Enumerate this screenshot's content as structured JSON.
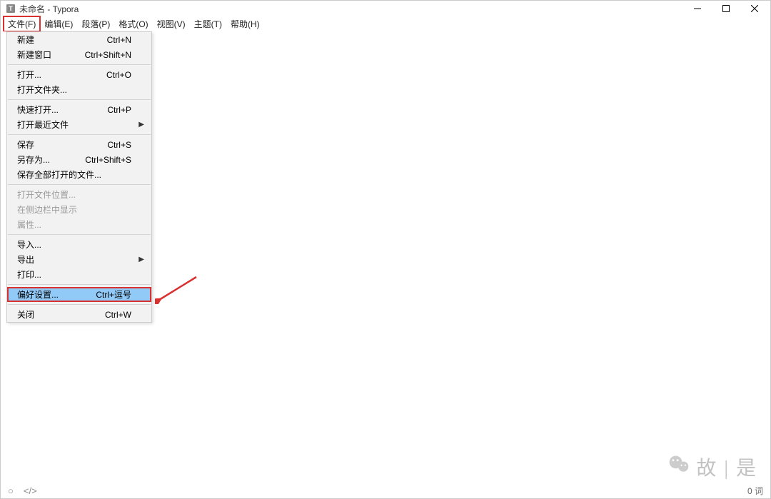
{
  "titlebar": {
    "app_icon_letter": "T",
    "title": "未命名 - Typora"
  },
  "menubar": {
    "items": [
      {
        "label": "文件(F)",
        "highlighted": true
      },
      {
        "label": "编辑(E)"
      },
      {
        "label": "段落(P)"
      },
      {
        "label": "格式(O)"
      },
      {
        "label": "视图(V)"
      },
      {
        "label": "主题(T)"
      },
      {
        "label": "帮助(H)"
      }
    ]
  },
  "dropdown": {
    "groups": [
      [
        {
          "label": "新建",
          "shortcut": "Ctrl+N"
        },
        {
          "label": "新建窗口",
          "shortcut": "Ctrl+Shift+N"
        }
      ],
      [
        {
          "label": "打开...",
          "shortcut": "Ctrl+O"
        },
        {
          "label": "打开文件夹..."
        }
      ],
      [
        {
          "label": "快速打开...",
          "shortcut": "Ctrl+P"
        },
        {
          "label": "打开最近文件",
          "submenu": true
        }
      ],
      [
        {
          "label": "保存",
          "shortcut": "Ctrl+S"
        },
        {
          "label": "另存为...",
          "shortcut": "Ctrl+Shift+S"
        },
        {
          "label": "保存全部打开的文件..."
        }
      ],
      [
        {
          "label": "打开文件位置...",
          "disabled": true
        },
        {
          "label": "在侧边栏中显示",
          "disabled": true
        },
        {
          "label": "属性...",
          "disabled": true
        }
      ],
      [
        {
          "label": "导入..."
        },
        {
          "label": "导出",
          "submenu": true
        },
        {
          "label": "打印..."
        }
      ],
      [
        {
          "label": "偏好设置...",
          "shortcut": "Ctrl+逗号",
          "highlighted": true
        }
      ],
      [
        {
          "label": "关闭",
          "shortcut": "Ctrl+W"
        }
      ]
    ]
  },
  "statusbar": {
    "word_count": "0 词"
  },
  "watermark": {
    "text": "故 | 是"
  },
  "annotation": {
    "arrow_color": "#d93030"
  }
}
